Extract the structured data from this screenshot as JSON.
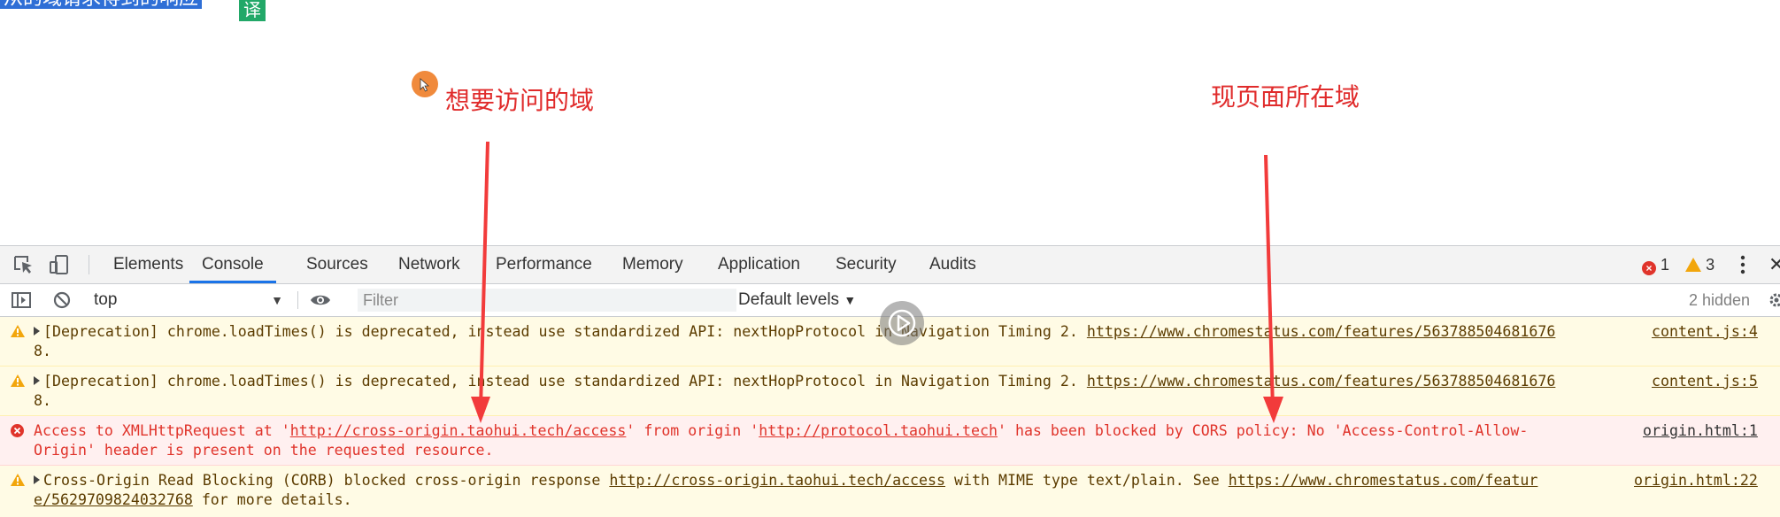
{
  "page": {
    "clipped_text": "从的域请求得到的响应",
    "translate_badge": "译",
    "annotation_left": "想要访问的域",
    "annotation_right": "现页面所在域",
    "annotation_color": "#e02b2b"
  },
  "devtools": {
    "tabs": [
      {
        "label": "Elements",
        "active": false
      },
      {
        "label": "Console",
        "active": true
      },
      {
        "label": "Sources",
        "active": false
      },
      {
        "label": "Network",
        "active": false
      },
      {
        "label": "Performance",
        "active": false
      },
      {
        "label": "Memory",
        "active": false
      },
      {
        "label": "Application",
        "active": false
      },
      {
        "label": "Security",
        "active": false
      },
      {
        "label": "Audits",
        "active": false
      }
    ],
    "error_count": "1",
    "warning_count": "3",
    "filterbar": {
      "context": "top",
      "filter_placeholder": "Filter",
      "levels": "Default levels",
      "hidden": "2 hidden"
    },
    "messages": [
      {
        "level": "warning",
        "line1": "[Deprecation] chrome.loadTimes() is deprecated, instead use standardized API: nextHopProtocol in Navigation Timing 2. ",
        "link": "https://www.chromestatus.com/features/563788504681676",
        "line2": "8.",
        "source": "content.js:4"
      },
      {
        "level": "warning",
        "line1": "[Deprecation] chrome.loadTimes() is deprecated, instead use standardized API: nextHopProtocol in Navigation Timing 2. ",
        "link": "https://www.chromestatus.com/features/563788504681676",
        "line2": "8.",
        "source": "content.js:5"
      },
      {
        "level": "error",
        "p1": "Access to XMLHttpRequest at '",
        "url1": "http://cross-origin.taohui.tech/access",
        "p2": "' from origin '",
        "url2": "http://protocol.taohui.tech",
        "p3": "' has been blocked by CORS policy: No 'Access-Control-Allow-",
        "line2": "Origin' header is present on the requested resource.",
        "source": "origin.html:1"
      },
      {
        "level": "warning",
        "p1": "Cross-Origin Read Blocking (CORB) blocked cross-origin response ",
        "url1": "http://cross-origin.taohui.tech/access",
        "p2": " with MIME type text/plain. See ",
        "url2": "https://www.chromestatus.com/featur",
        "line2_link": "e/5629709824032768",
        "line2_rest": " for more details.",
        "source": "origin.html:22"
      }
    ]
  }
}
